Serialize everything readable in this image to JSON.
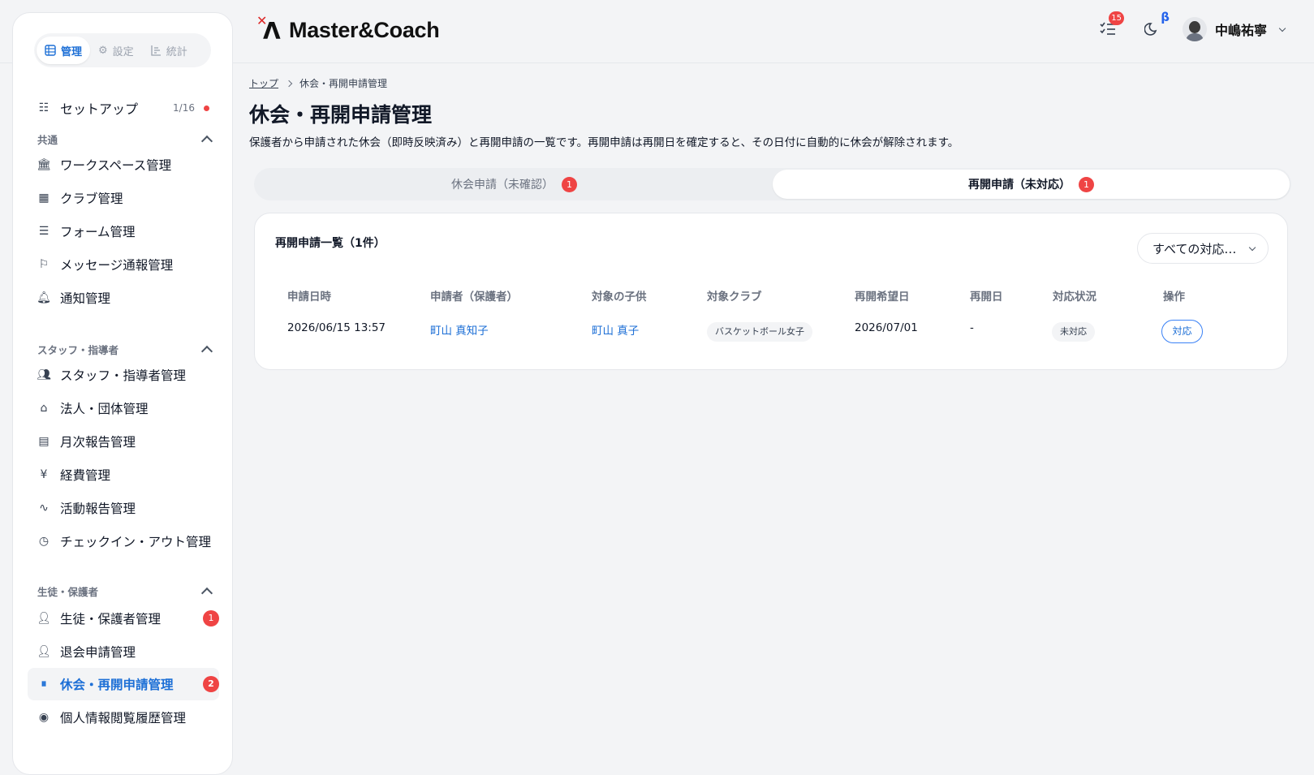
{
  "header": {
    "brand": "Master&Coach",
    "tasks_badge": "15",
    "beta_label": "β",
    "user_name": "中嶋祐寧"
  },
  "sidebar": {
    "modes": [
      {
        "label": "管理",
        "icon": "grid-icon",
        "active": true
      },
      {
        "label": "設定",
        "icon": "gear-icon",
        "active": false
      },
      {
        "label": "統計",
        "icon": "bar-chart-icon",
        "active": false
      }
    ],
    "setup": {
      "label": "セットアップ",
      "count": "1/16"
    },
    "sections": [
      {
        "label": "共通",
        "items": [
          {
            "label": "ワークスペース管理",
            "icon": "bank-icon"
          },
          {
            "label": "クラブ管理",
            "icon": "building-icon"
          },
          {
            "label": "フォーム管理",
            "icon": "form-icon"
          },
          {
            "label": "メッセージ通報管理",
            "icon": "flag-icon"
          },
          {
            "label": "通知管理",
            "icon": "bell-icon"
          }
        ]
      },
      {
        "label": "スタッフ・指導者",
        "items": [
          {
            "label": "スタッフ・指導者管理",
            "icon": "users-icon"
          },
          {
            "label": "法人・団体管理",
            "icon": "organization-icon"
          },
          {
            "label": "月次報告管理",
            "icon": "calendar-icon"
          },
          {
            "label": "経費管理",
            "icon": "yen-icon"
          },
          {
            "label": "活動報告管理",
            "icon": "activity-icon"
          },
          {
            "label": "チェックイン・アウト管理",
            "icon": "clock-icon"
          }
        ]
      },
      {
        "label": "生徒・保護者",
        "items": [
          {
            "label": "生徒・保護者管理",
            "icon": "user-plus-icon",
            "badge": "1"
          },
          {
            "label": "退会申請管理",
            "icon": "user-x-icon"
          },
          {
            "label": "休会・再開申請管理",
            "icon": "pause-circle-icon",
            "badge": "2",
            "active": true
          },
          {
            "label": "個人情報閲覧履歴管理",
            "icon": "eye-icon"
          }
        ]
      }
    ]
  },
  "breadcrumb": {
    "home": "トップ",
    "current": "休会・再開申請管理"
  },
  "page": {
    "title": "休会・再開申請管理",
    "description": "保護者から申請された休会（即時反映済み）と再開申請の一覧です。再開申請は再開日を確定すると、その日付に自動的に休会が解除されます。"
  },
  "tabs": [
    {
      "label": "休会申請（未確認）",
      "badge": "1",
      "active": false
    },
    {
      "label": "再開申請（未対応）",
      "badge": "1",
      "active": true
    }
  ],
  "list": {
    "title": "再開申請一覧（1件）",
    "filter_value": "すべての対応…",
    "columns": [
      "申請日時",
      "申請者（保護者）",
      "対象の子供",
      "対象クラブ",
      "再開希望日",
      "再開日",
      "対応状況",
      "操作"
    ],
    "rows": [
      {
        "applied_at": "2026/06/15 13:57",
        "applicant": "町山 真知子",
        "child": "町山 真子",
        "club": "バスケットボール女子",
        "requested_date": "2026/07/01",
        "resume_date": "-",
        "status": "未対応",
        "action": "対応"
      }
    ]
  },
  "colors": {
    "accent": "#1d6fd6",
    "badge": "#ef4444",
    "background": "#f3f4f6"
  }
}
